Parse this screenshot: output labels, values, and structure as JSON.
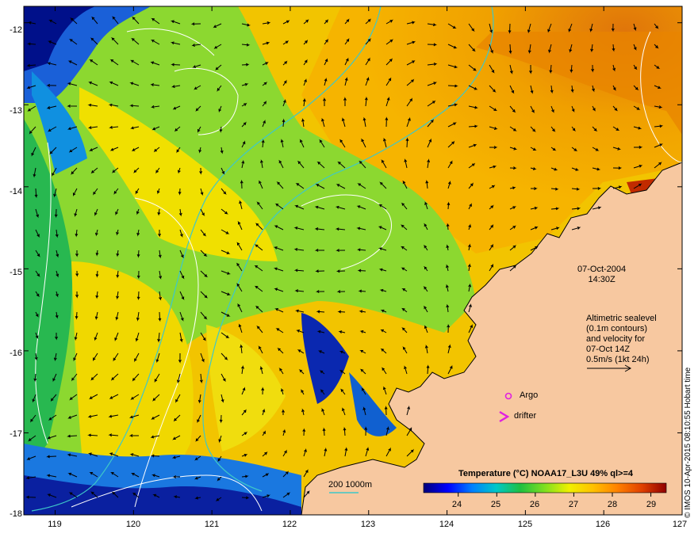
{
  "map": {
    "lat_ticks": [
      "-12",
      "-13",
      "-14",
      "-15",
      "-16",
      "-17",
      "-18"
    ],
    "lon_ticks": [
      "119",
      "120",
      "121",
      "122",
      "123",
      "124",
      "125",
      "126",
      "127"
    ],
    "lat_range": [
      -18,
      -11.8
    ],
    "lon_range": [
      118.6,
      127
    ],
    "land_color": "#f7c8a0",
    "frame_color": "#000000",
    "contour_color": "#ffffff",
    "isobath_color": "#3ec8c8"
  },
  "annotations": {
    "date": "07-Oct-2004",
    "time": "14:30Z",
    "altimetry_lines": [
      "Altimetric sealevel",
      "(0.1m contours)",
      "and velocity for",
      "07-Oct 14Z",
      "0.5m/s (1kt 24h)"
    ],
    "argo": "Argo",
    "drifter": "drifter",
    "isobaths": "200  1000m",
    "credit": "© IMOS 10-Apr-2015 08:10:55 Hobart time",
    "argo_color": "#e020e0",
    "drifter_color": "#e020e0"
  },
  "colorbar": {
    "title": "Temperature (°C) NOAA17_L3U 49% ql>=4",
    "ticks": [
      "24",
      "25",
      "26",
      "27",
      "28",
      "29"
    ],
    "range": [
      23.1,
      29.4
    ],
    "colors": [
      "#00007a",
      "#0000ff",
      "#0080ff",
      "#00c8c8",
      "#20c040",
      "#80e020",
      "#f0f000",
      "#ffc000",
      "#ff8000",
      "#e04000",
      "#900000"
    ]
  }
}
